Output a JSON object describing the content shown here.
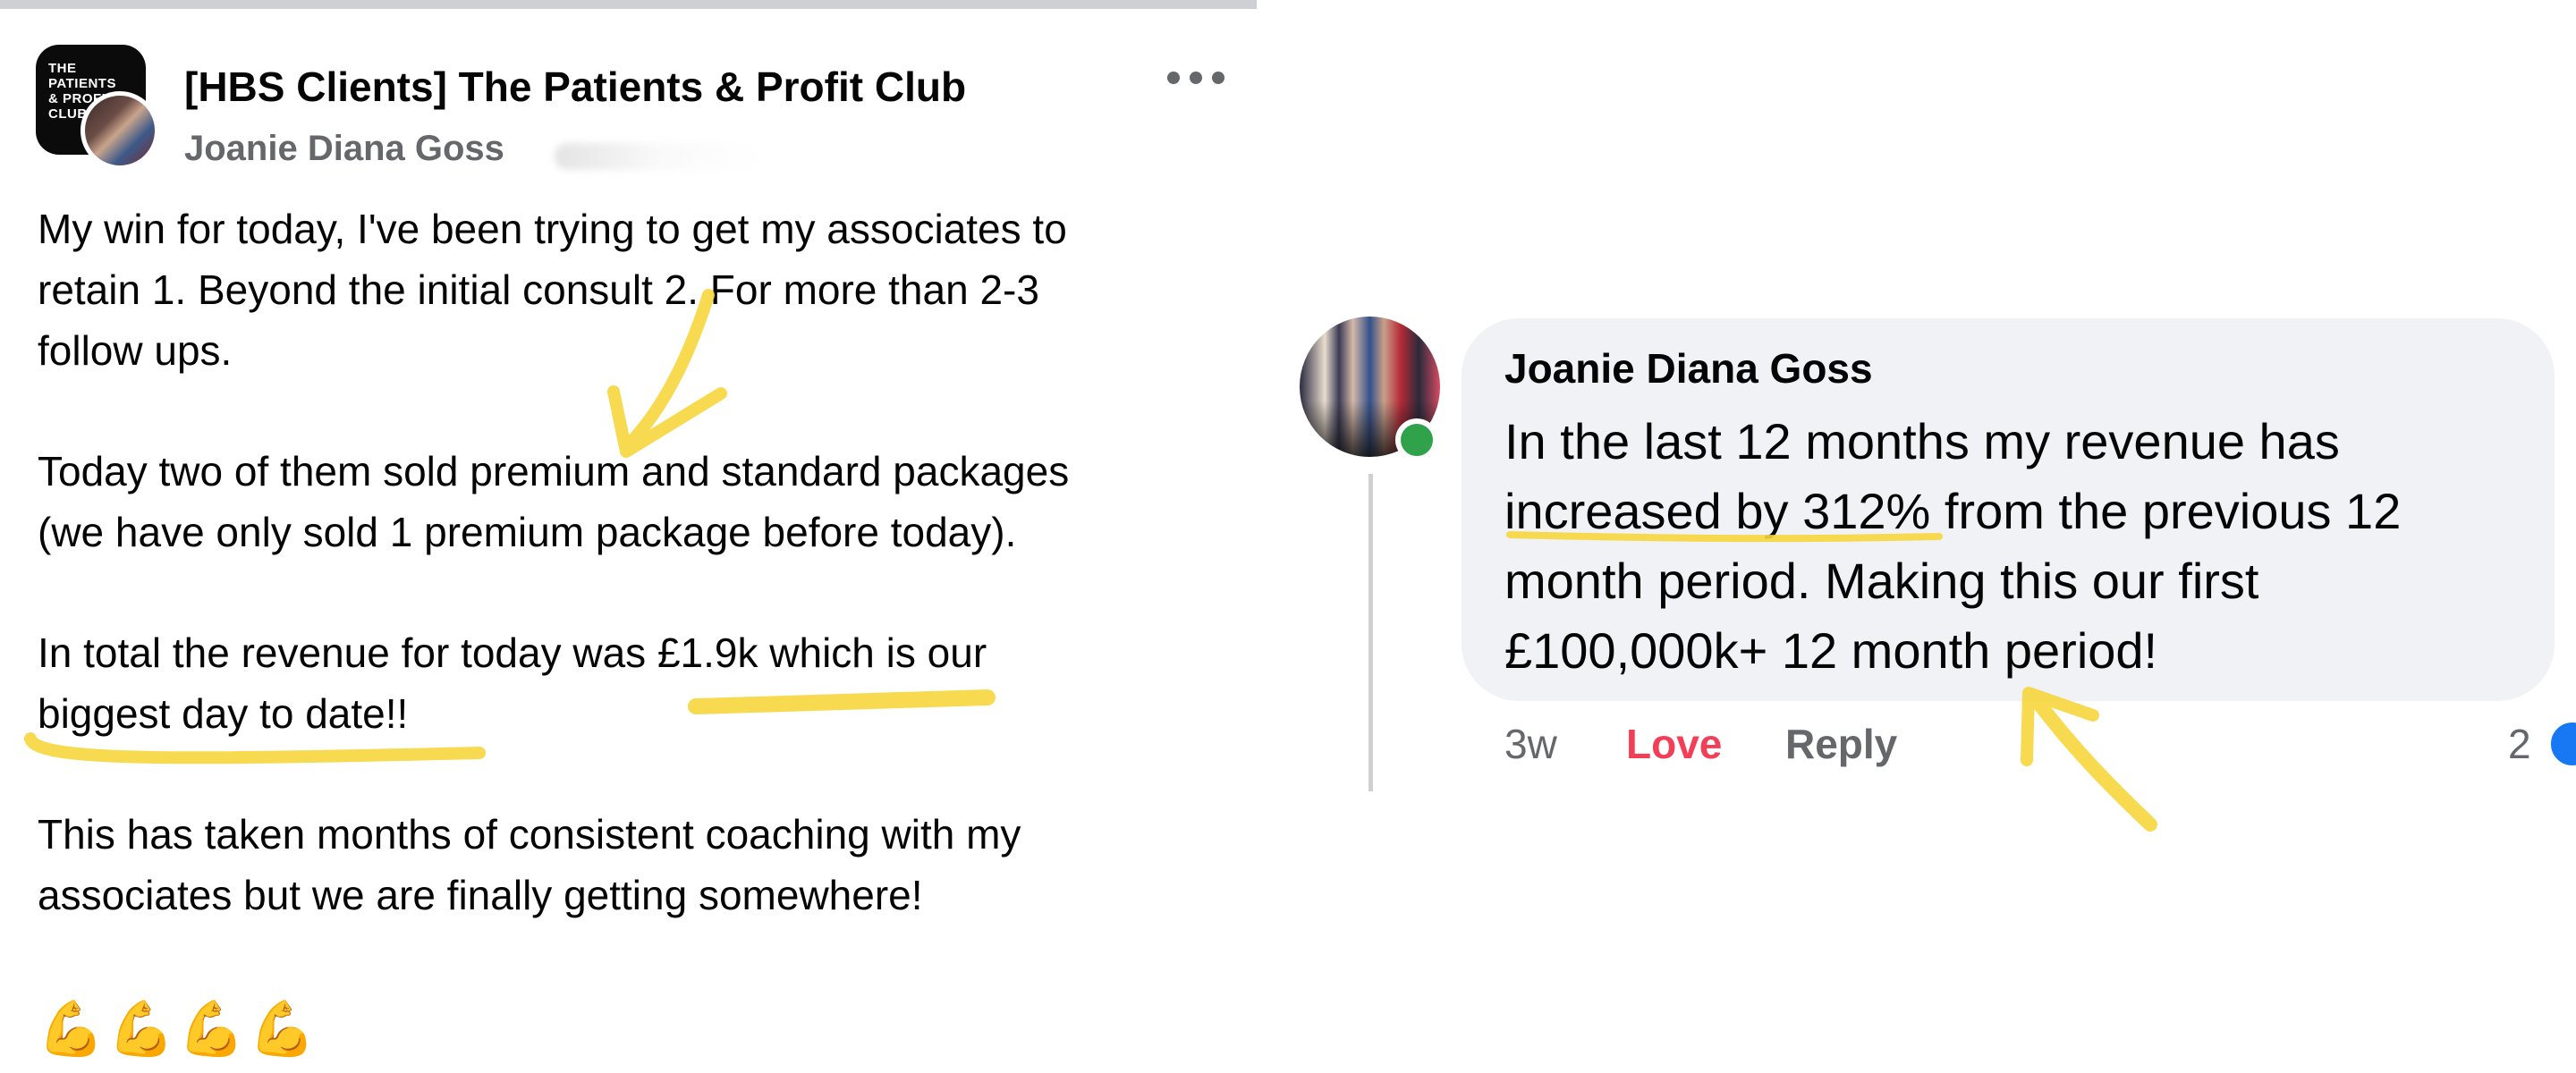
{
  "post": {
    "group_name": "[HBS Clients] The Patients & Profit Club",
    "group_logo_text": "THE PATIENTS & PROFIT CLUB",
    "author": "Joanie Diana Goss",
    "more_icon": "more-horizontal-icon",
    "paragraphs": [
      "My win for today, I've been trying to get my associates to\nretain 1. Beyond the initial consult 2. For more than 2-3\nfollow ups.",
      "Today two of them sold premium and standard packages\n(we have only sold 1 premium package before today).",
      "In total the revenue for today was £1.9k which is our\nbiggest day to date!!",
      "This has taken months of consistent coaching with my\nassociates but we are finally getting somewhere!"
    ],
    "emoji": "💪💪💪💪"
  },
  "comment": {
    "author": "Joanie Diana Goss",
    "text": "In the last 12 months my revenue has\nincreased by 312% from the previous 12\nmonth period. Making this our first\n£100,000k+ 12 month period!",
    "time": "3w",
    "love_label": "Love",
    "reply_label": "Reply",
    "reaction_count": "2",
    "online_status_color": "#31a24c",
    "love_color": "#f33e58"
  },
  "annotation_color": "#f7d63e"
}
